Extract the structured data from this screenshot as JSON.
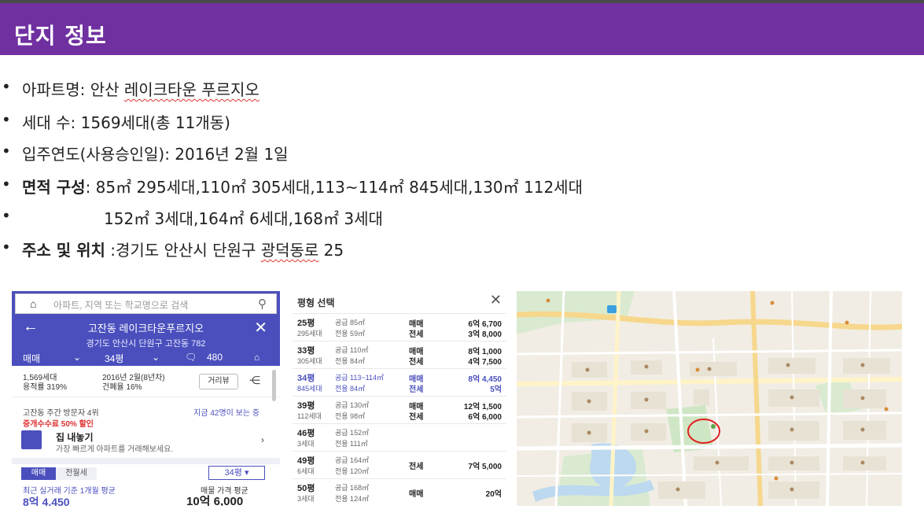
{
  "header": {
    "title": "단지 정보"
  },
  "bullets": {
    "b1_label": "아파트명: 안산 ",
    "b1_name": "레이크타운 푸르지오",
    "b2": "세대 수: 1569세대(총 11개동)",
    "b3": "입주연도(사용승인일): 2016년 2월 1일",
    "b4_label": "면적 구성",
    "b4_value": ": 85㎡ 295세대,110㎡ 305세대,113~114㎡ 845세대,130㎡ 112세대",
    "b5": "152㎡ 3세대,164㎡ 6세대,168㎡ 3세대",
    "b6_label": "주소  및 위치",
    "b6_value_a": " :경기도 안산시 단원구 ",
    "b6_value_b": "광덕동로",
    "b6_value_c": " 25"
  },
  "app": {
    "search_placeholder": "아파트, 지역 또는 학교명으로 검색",
    "complex_title": "고잔동 레이크타운푸르지오",
    "address": "경기도 안산시 단원구 고잔동 782",
    "tab_trade": "매매",
    "tab_area": "34평",
    "comment_count": "480",
    "units": "1,569세대",
    "far": "용적률 319%",
    "built": "2016년 2월(8년차)",
    "bcr": "건폐율 16%",
    "street_view": "거리뷰",
    "visitors": "고잔동 주간 방문자 4위",
    "viewing_now": "지금 42명이 보는 중",
    "promo": "중개수수료 50% 할인",
    "sell_title": "집 내놓기",
    "sell_sub": "가장 빠르게 아파트를 거래해보세요.",
    "seg_trade": "매매",
    "seg_rent": "전월세",
    "area_select": "34평 ▾",
    "recent_note": "최근 실거래 기준 1개월 평균",
    "avg_label": "매물 가격 평균",
    "recent_price": "8억 4,450",
    "avg_price": "10억 6,000"
  },
  "area_panel": {
    "title": "평형 선택",
    "rows": [
      {
        "py": "25평",
        "hh": "295세대",
        "s1": "공급 85㎡",
        "s2": "전용 59㎡",
        "k1": "매매",
        "k2": "전세",
        "v1": "6억 6,700",
        "v2": "3억 8,000"
      },
      {
        "py": "33평",
        "hh": "305세대",
        "s1": "공급 110㎡",
        "s2": "전용 84㎡",
        "k1": "매매",
        "k2": "전세",
        "v1": "8억 1,000",
        "v2": "4억 7,500"
      },
      {
        "py": "34평",
        "hh": "845세대",
        "s1": "공급 113~114㎡",
        "s2": "전용 84㎡",
        "k1": "매매",
        "k2": "전세",
        "v1": "8억 4,450",
        "v2": "5억"
      },
      {
        "py": "39평",
        "hh": "112세대",
        "s1": "공급 130㎡",
        "s2": "전용 98㎡",
        "k1": "매매",
        "k2": "전세",
        "v1": "12억 1,500",
        "v2": "6억 6,000"
      },
      {
        "py": "46평",
        "hh": "3세대",
        "s1": "공급 152㎡",
        "s2": "전용 111㎡",
        "k1": "",
        "k2": "",
        "v1": "",
        "v2": ""
      },
      {
        "py": "49평",
        "hh": "6세대",
        "s1": "공급 164㎡",
        "s2": "전용 120㎡",
        "k1": "전세",
        "k2": "",
        "v1": "7억 5,000",
        "v2": ""
      },
      {
        "py": "50평",
        "hh": "3세대",
        "s1": "공급 168㎡",
        "s2": "전용 124㎡",
        "k1": "매매",
        "k2": "",
        "v1": "20억",
        "v2": ""
      }
    ]
  },
  "icons": {
    "home": "⌂",
    "search": "⚲",
    "back": "←",
    "close": "✕",
    "comment": "🗨",
    "share": "⋲",
    "arrow": "›"
  },
  "colors": {
    "header": "#7030a0",
    "app_primary": "#4a4fbd",
    "promo": "#e03030",
    "map_marker": "#e02020"
  }
}
